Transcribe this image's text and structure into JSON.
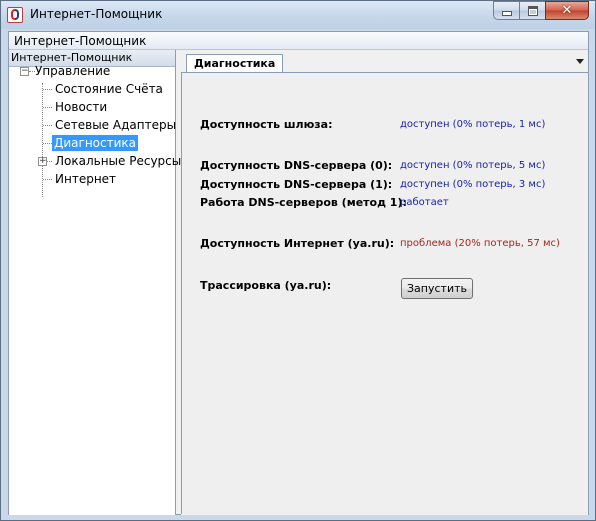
{
  "window": {
    "title": "Интернет-Помощник"
  },
  "menu": {
    "items": [
      "Интернет-Помощник"
    ]
  },
  "left_panel": {
    "header": "Интернет-Помощник",
    "tree": {
      "root": "Управление",
      "children": [
        "Состояние Счёта",
        "Новости",
        "Сетевые Адаптеры",
        "Диагностика",
        "Локальные Ресурсы",
        "Интернет"
      ],
      "selected": "Диагностика"
    }
  },
  "tabs": {
    "active": "Диагностика"
  },
  "diagnostics": {
    "rows": [
      {
        "label": "Доступность шлюза:",
        "value": "доступен (0% потерь, 1 мс)",
        "status": "ok"
      },
      {
        "label": "Доступность DNS-сервера (0):",
        "value": "доступен (0% потерь, 5 мс)",
        "status": "ok"
      },
      {
        "label": "Доступность DNS-сервера (1):",
        "value": "доступен (0% потерь, 3 мс)",
        "status": "ok"
      },
      {
        "label": "Работа DNS-серверов (метод 1):",
        "value": "работает",
        "status": "ok"
      },
      {
        "label": "Доступность Интернет (ya.ru):",
        "value": "проблема (20% потерь, 57 мс)",
        "status": "problem"
      },
      {
        "label": "Трассировка (ya.ru):",
        "value": "",
        "status": "action"
      }
    ],
    "run_button": "Запустить"
  },
  "colors": {
    "ok": "#1a22a8",
    "problem": "#a2281c",
    "selection": "#3399ff"
  },
  "icons": [
    "app-icon",
    "minimize-icon",
    "maximize-icon",
    "close-icon",
    "tree-collapse-icon",
    "tree-expand-icon",
    "tab-dropdown-icon"
  ]
}
